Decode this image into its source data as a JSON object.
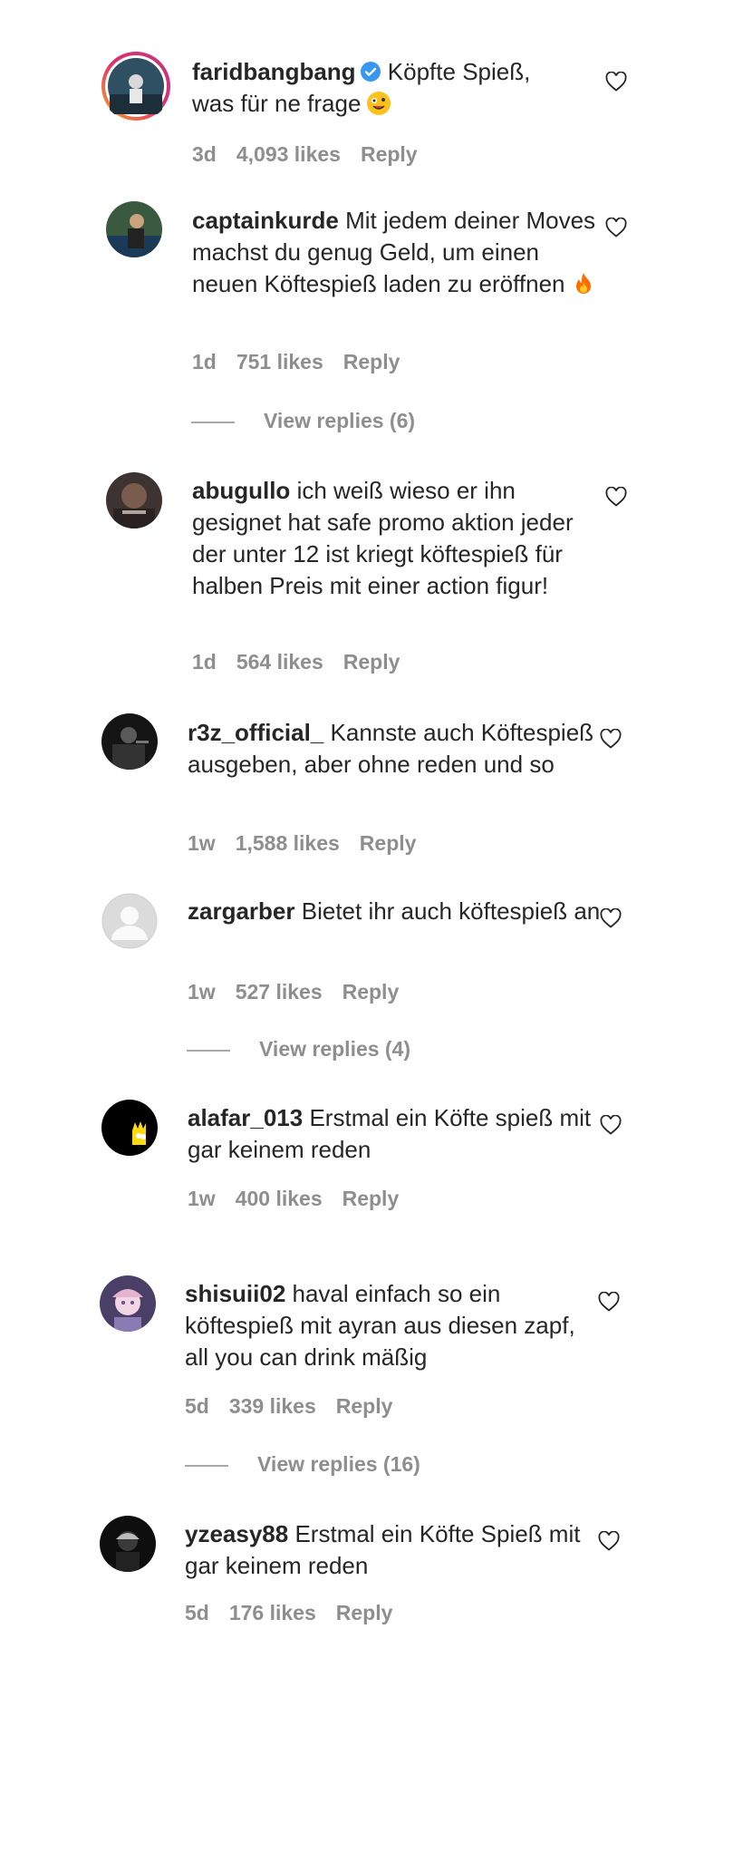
{
  "comments": [
    {
      "username": "faridbangbang",
      "text": "Köpfte Spieß, was für ne frage",
      "time": "3d",
      "likes": "4,093 likes",
      "reply": "Reply",
      "verified": true,
      "emoji": "zany-face-icon"
    },
    {
      "username": "captainkurde",
      "text": "Mit jedem deiner Moves machst du genug Geld, um einen neuen Köftespieß laden zu eröffnen",
      "time": "1d",
      "likes": "751 likes",
      "reply": "Reply",
      "emoji": "fire-icon",
      "view_replies": "View replies (6)"
    },
    {
      "username": "abugullo",
      "text": "ich weiß wieso er ihn gesignet hat safe promo aktion jeder der unter 12 ist kriegt köftespieß für halben Preis mit einer action figur!",
      "time": "1d",
      "likes": "564 likes",
      "reply": "Reply"
    },
    {
      "username": "r3z_official_",
      "text": "Kannste auch Köftespieß ausgeben, aber ohne reden und so",
      "time": "1w",
      "likes": "1,588 likes",
      "reply": "Reply"
    },
    {
      "username": "zargarber",
      "text": "Bietet ihr auch köftespieß an",
      "time": "1w",
      "likes": "527 likes",
      "reply": "Reply",
      "view_replies": "View replies (4)"
    },
    {
      "username": "alafar_013",
      "text": "Erstmal ein Köfte spieß mit gar keinem reden",
      "time": "1w",
      "likes": "400 likes",
      "reply": "Reply"
    },
    {
      "username": "shisuii02",
      "text": "haval einfach so ein köftespieß mit ayran aus diesen zapf, all you can drink mäßig",
      "time": "5d",
      "likes": "339 likes",
      "reply": "Reply",
      "view_replies": "View replies (16)"
    },
    {
      "username": "yzeasy88",
      "text": "Erstmal ein Köfte Spieß mit gar keinem reden",
      "time": "5d",
      "likes": "176 likes",
      "reply": "Reply"
    }
  ]
}
